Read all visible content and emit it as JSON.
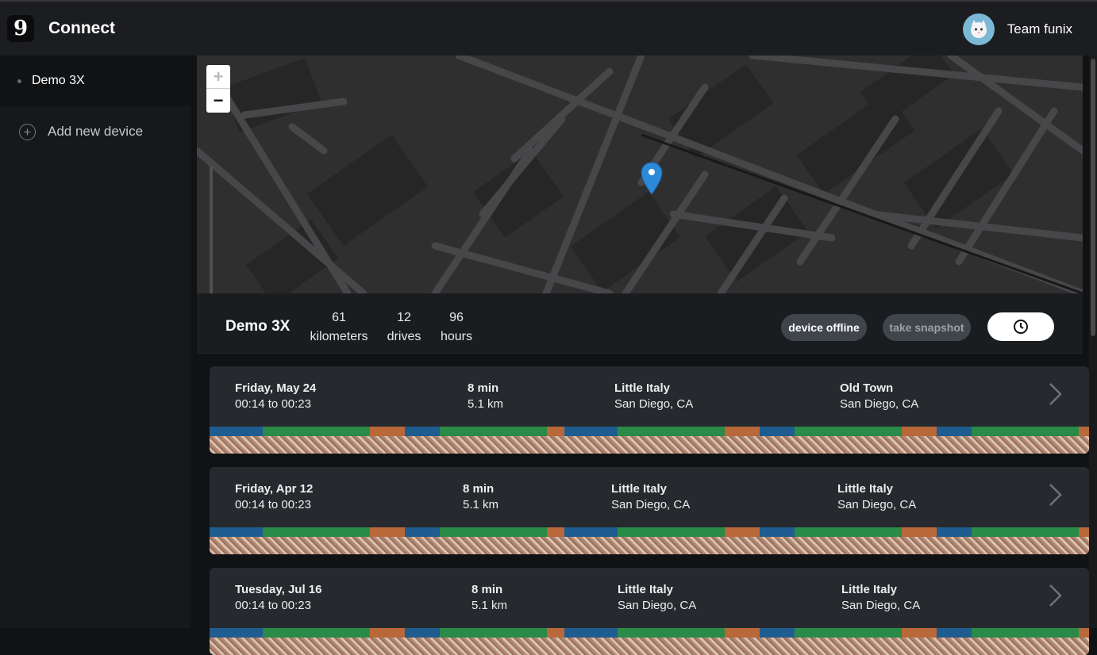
{
  "app": {
    "logo_glyph": "9",
    "title": "Connect"
  },
  "user": {
    "name": "Team funix"
  },
  "sidebar": {
    "device": "Demo 3X",
    "add_device": "Add new device"
  },
  "map": {
    "zoom_in": "+",
    "zoom_out": "−"
  },
  "device_stats": {
    "name": "Demo 3X",
    "kilometers_value": "61",
    "kilometers_label": "kilometers",
    "drives_value": "12",
    "drives_label": "drives",
    "hours_value": "96",
    "hours_label": "hours",
    "offline_button": "device offline",
    "snapshot_button": "take snapshot"
  },
  "drives": [
    {
      "date": "Friday, May 24",
      "time": "00:14 to 00:23",
      "duration": "8 min",
      "distance": "5.1 km",
      "start_place": "Little Italy",
      "start_city": "San Diego, CA",
      "end_place": "Old Town",
      "end_city": "San Diego, CA"
    },
    {
      "date": "Friday, Apr 12",
      "time": "00:14 to 00:23",
      "duration": "8 min",
      "distance": "5.1 km",
      "start_place": "Little Italy",
      "start_city": "San Diego, CA",
      "end_place": "Little Italy",
      "end_city": "San Diego, CA"
    },
    {
      "date": "Tuesday, Jul 16",
      "time": "00:14 to 00:23",
      "duration": "8 min",
      "distance": "5.1 km",
      "start_place": "Little Italy",
      "start_city": "San Diego, CA",
      "end_place": "Little Italy",
      "end_city": "San Diego, CA"
    }
  ],
  "colors": {
    "accent_blue": "#1f5c8f",
    "engaged_green": "#2a8a48",
    "override_orange": "#b9683a",
    "pin_blue": "#2d8ad8"
  }
}
